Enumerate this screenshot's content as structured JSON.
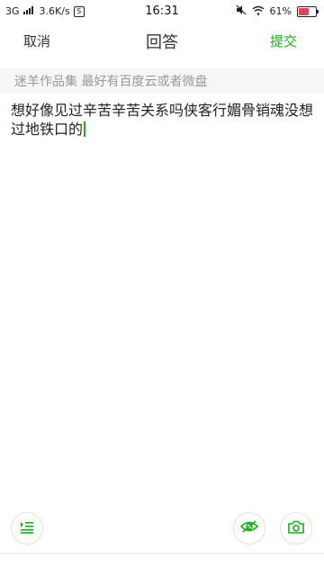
{
  "status_bar": {
    "network": "3G",
    "speed": "3.6K/s",
    "time": "16:31",
    "battery_text": "61%",
    "battery_level": 0.61,
    "sim_badge": "S"
  },
  "nav": {
    "cancel_label": "取消",
    "title": "回答",
    "submit_label": "提交"
  },
  "question": {
    "text": "迷羊作品集 最好有百度云或者微盘"
  },
  "answer": {
    "text": "想好像见过辛苦辛苦关系吗侠客行媚骨销魂没想过地铁口的"
  },
  "colors": {
    "accent": "#1aad19",
    "battery_low": "#e1445a"
  },
  "toolbar": {
    "icons": [
      "list-format-icon",
      "eye-hide-icon",
      "camera-icon"
    ]
  }
}
